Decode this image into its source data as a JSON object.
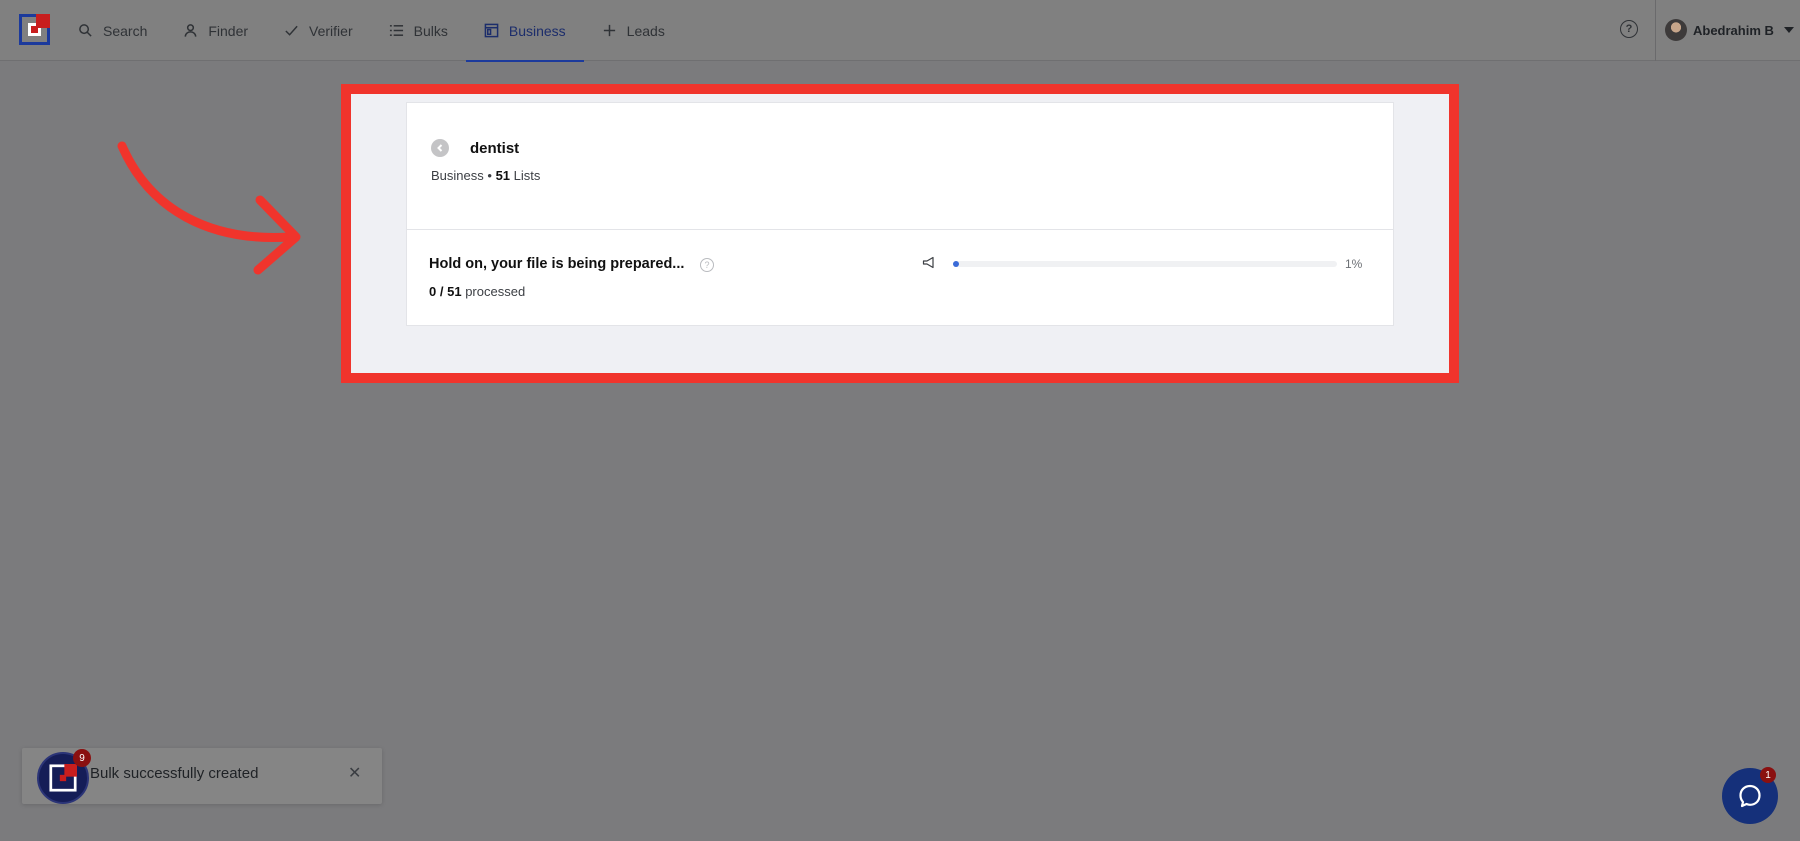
{
  "nav": {
    "items": [
      {
        "label": "Search",
        "icon": "search-icon"
      },
      {
        "label": "Finder",
        "icon": "user-icon"
      },
      {
        "label": "Verifier",
        "icon": "check-icon"
      },
      {
        "label": "Bulks",
        "icon": "list-icon"
      },
      {
        "label": "Business",
        "icon": "business-icon",
        "active": true
      },
      {
        "label": "Leads",
        "icon": "plus-icon"
      }
    ],
    "help_label": "?",
    "user_name": "Abedrahim B"
  },
  "business": {
    "title": "dentist",
    "category": "Business",
    "separator": "•",
    "lists_count": "51",
    "lists_label": "Lists"
  },
  "progress": {
    "heading": "Hold on, your file is being prepared...",
    "info": "?",
    "processed_done": "0",
    "processed_total": "51",
    "processed_sep": "/",
    "processed_label": "processed",
    "percent_value": 1,
    "percent_label": "1%"
  },
  "toast": {
    "message": "Bulk successfully created",
    "badge": "9",
    "close": "✕"
  },
  "chat": {
    "badge": "1"
  },
  "colors": {
    "accent": "#1c3a9c",
    "highlight": "#f0342c",
    "progress": "#3a6bd8"
  }
}
